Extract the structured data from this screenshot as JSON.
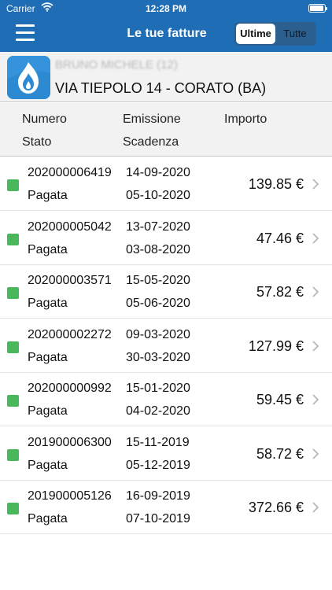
{
  "status_bar": {
    "carrier": "Carrier",
    "time": "12:28 PM",
    "battery_level": 0.95
  },
  "nav": {
    "title": "Le tue fatture",
    "segments": [
      "Ultime",
      "Tutte"
    ],
    "selected_segment": "Ultime"
  },
  "account": {
    "name": "BRUNO MICHELE   (12)",
    "address": "VIA TIEPOLO 14 - CORATO (BA)"
  },
  "columns": {
    "numero": "Numero",
    "stato": "Stato",
    "emissione": "Emissione",
    "scadenza": "Scadenza",
    "importo": "Importo"
  },
  "invoices": [
    {
      "numero": "202000006419",
      "stato": "Pagata",
      "emissione": "14-09-2020",
      "scadenza": "05-10-2020",
      "importo": "139.85 €"
    },
    {
      "numero": "202000005042",
      "stato": "Pagata",
      "emissione": "13-07-2020",
      "scadenza": "03-08-2020",
      "importo": "47.46 €"
    },
    {
      "numero": "202000003571",
      "stato": "Pagata",
      "emissione": "15-05-2020",
      "scadenza": "05-06-2020",
      "importo": "57.82 €"
    },
    {
      "numero": "202000002272",
      "stato": "Pagata",
      "emissione": "09-03-2020",
      "scadenza": "30-03-2020",
      "importo": "127.99 €"
    },
    {
      "numero": "202000000992",
      "stato": "Pagata",
      "emissione": "15-01-2020",
      "scadenza": "04-02-2020",
      "importo": "59.45 €"
    },
    {
      "numero": "201900006300",
      "stato": "Pagata",
      "emissione": "15-11-2019",
      "scadenza": "05-12-2019",
      "importo": "58.72 €"
    },
    {
      "numero": "201900005126",
      "stato": "Pagata",
      "emissione": "16-09-2019",
      "scadenza": "07-10-2019",
      "importo": "372.66 €"
    }
  ],
  "colors": {
    "nav_blue": "#1f6db5",
    "paid_green": "#4ab85a"
  },
  "icons": {
    "menu": "hamburger-menu-icon",
    "wifi": "wifi-icon",
    "battery": "battery-icon",
    "logo": "gas-flame-logo",
    "status": "paid-status-icon",
    "disclosure": "chevron-right-icon"
  }
}
